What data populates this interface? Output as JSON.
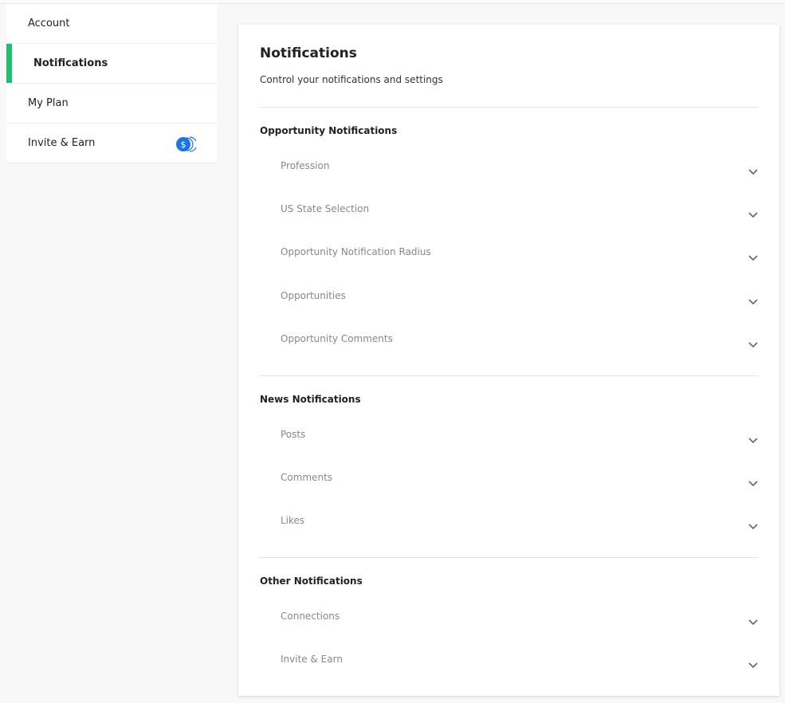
{
  "sidebar": {
    "items": [
      {
        "label": "Account"
      },
      {
        "label": "Notifications"
      },
      {
        "label": "My Plan"
      },
      {
        "label": "Invite & Earn",
        "badge_icon": "dollar-coins-icon"
      }
    ],
    "active_index": 1
  },
  "main": {
    "title": "Notifications",
    "subtitle": "Control your notifications and settings",
    "sections": [
      {
        "title": "Opportunity Notifications",
        "rows": [
          "Profession",
          "US State Selection",
          "Opportunity Notification Radius",
          "Opportunities",
          "Opportunity Comments"
        ]
      },
      {
        "title": "News Notifications",
        "rows": [
          "Posts",
          "Comments",
          "Likes"
        ]
      },
      {
        "title": "Other Notifications",
        "rows": [
          "Connections",
          "Invite & Earn"
        ]
      }
    ]
  },
  "colors": {
    "accent": "#1fbf73",
    "badge": "#1a73e8",
    "muted_text": "#888888"
  }
}
